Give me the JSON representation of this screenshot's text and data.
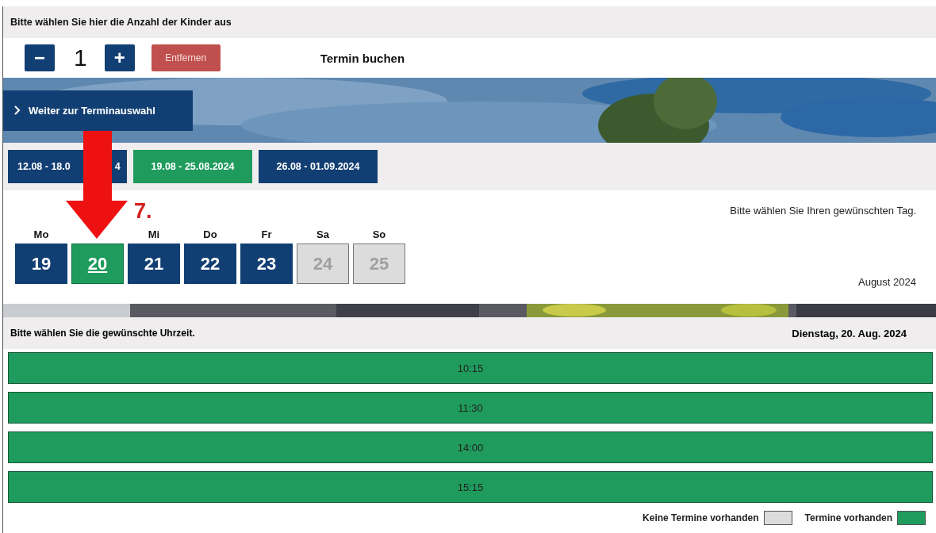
{
  "children_header": "Bitte wählen Sie hier die Anzahl der Kinder aus",
  "counter": {
    "minus": "−",
    "value": "1",
    "plus": "+",
    "remove_button": "Entfernen"
  },
  "page_title": "Termin buchen",
  "continue_button": "Weiter zur Terminauswahl",
  "weeks": [
    {
      "label_parts": [
        "12.08 - 18.0",
        "4"
      ],
      "selected": false
    },
    {
      "label_parts": [
        "19.08 - 25.08.2024"
      ],
      "selected": true
    },
    {
      "label_parts": [
        "26.08 - 01.09.2024"
      ],
      "selected": false
    }
  ],
  "annotation": {
    "step": "7."
  },
  "day_hint": "Bitte wählen Sie Ihren gewünschten Tag.",
  "days": [
    {
      "name": "Mo",
      "number": "19",
      "available": true,
      "selected": false
    },
    {
      "number": "20",
      "available": true,
      "selected": true
    },
    {
      "name": "Mi",
      "number": "21",
      "available": true,
      "selected": false
    },
    {
      "name": "Do",
      "number": "22",
      "available": true,
      "selected": false
    },
    {
      "name": "Fr",
      "number": "23",
      "available": true,
      "selected": false
    },
    {
      "name": "Sa",
      "number": "24",
      "available": false,
      "selected": false
    },
    {
      "name": "So",
      "number": "25",
      "available": false,
      "selected": false
    }
  ],
  "month": "August 2024",
  "time_header": "Bitte wählen Sie die gewünschte Uhrzeit.",
  "selected_date": "Dienstag, 20. Aug. 2024",
  "time_slots": [
    "10:15",
    "11:30",
    "14:00",
    "15:15"
  ],
  "legend": [
    {
      "label": "Keine Termine vorhanden",
      "color": "#dcdcdc"
    },
    {
      "label": "Termine vorhanden",
      "color": "#1f9c5d"
    }
  ]
}
